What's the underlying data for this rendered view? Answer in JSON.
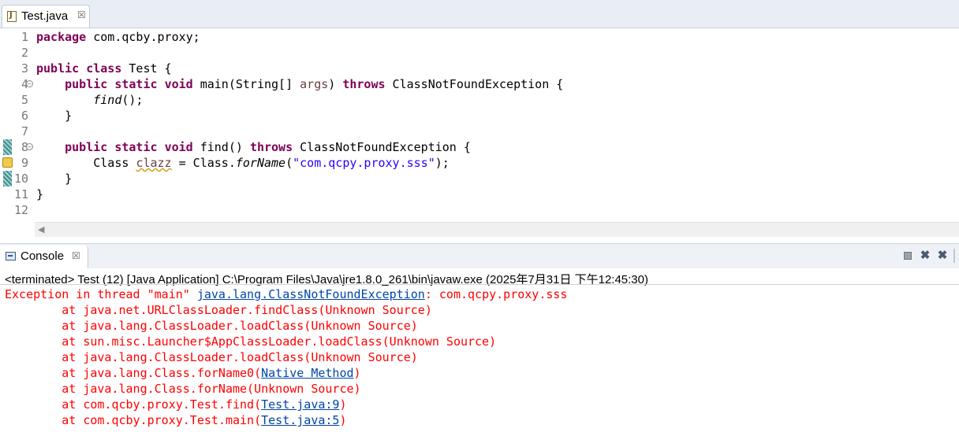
{
  "editor": {
    "tab": {
      "title": "Test.java",
      "close": "☒"
    },
    "lines": [
      {
        "num": "1",
        "tokens": [
          {
            "t": "package",
            "c": "kw"
          },
          {
            "t": " com.qcby.proxy;"
          }
        ]
      },
      {
        "num": "2",
        "tokens": []
      },
      {
        "num": "3",
        "tokens": [
          {
            "t": "public",
            "c": "kw"
          },
          {
            "t": " "
          },
          {
            "t": "class",
            "c": "kw"
          },
          {
            "t": " Test {"
          }
        ]
      },
      {
        "num": "4",
        "tokens": [
          {
            "t": "    "
          },
          {
            "t": "public",
            "c": "kw"
          },
          {
            "t": " "
          },
          {
            "t": "static",
            "c": "kw"
          },
          {
            "t": " "
          },
          {
            "t": "void",
            "c": "kw"
          },
          {
            "t": " main(String[] "
          },
          {
            "t": "args",
            "c": "param"
          },
          {
            "t": ") "
          },
          {
            "t": "throws",
            "c": "kw"
          },
          {
            "t": " ClassNotFoundException {"
          }
        ]
      },
      {
        "num": "5",
        "tokens": [
          {
            "t": "        "
          },
          {
            "t": "find",
            "c": "ital"
          },
          {
            "t": "();"
          }
        ]
      },
      {
        "num": "6",
        "tokens": [
          {
            "t": "    }"
          }
        ]
      },
      {
        "num": "7",
        "tokens": []
      },
      {
        "num": "8",
        "tokens": [
          {
            "t": "    "
          },
          {
            "t": "public",
            "c": "kw"
          },
          {
            "t": " "
          },
          {
            "t": "static",
            "c": "kw"
          },
          {
            "t": " "
          },
          {
            "t": "void",
            "c": "kw"
          },
          {
            "t": " find() "
          },
          {
            "t": "throws",
            "c": "kw"
          },
          {
            "t": " ClassNotFoundException {"
          }
        ]
      },
      {
        "num": "9",
        "tokens": [
          {
            "t": "        Class "
          },
          {
            "t": "clazz",
            "c": "warnvar"
          },
          {
            "t": " = Class."
          },
          {
            "t": "forName",
            "c": "ital"
          },
          {
            "t": "("
          },
          {
            "t": "\"com.qcpy.proxy.sss\"",
            "c": "str"
          },
          {
            "t": ");"
          }
        ]
      },
      {
        "num": "10",
        "tokens": [
          {
            "t": "    }"
          }
        ]
      },
      {
        "num": "11",
        "tokens": [
          {
            "t": "}"
          }
        ]
      },
      {
        "num": "12",
        "tokens": []
      }
    ]
  },
  "console": {
    "tab": {
      "title": "Console",
      "close": "☒"
    },
    "toolbar": {
      "remove": "✖",
      "remove_all": "✖"
    },
    "status": "<terminated> Test (12) [Java Application] C:\\Program Files\\Java\\jre1.8.0_261\\bin\\javaw.exe (2025年7月31日 下午12:45:30)",
    "output": [
      [
        {
          "t": "Exception in thread \"main\" "
        },
        {
          "t": "java.lang.ClassNotFoundException",
          "c": "link"
        },
        {
          "t": ": com.qcpy.proxy.sss"
        }
      ],
      [
        {
          "t": "\tat java.net.URLClassLoader.findClass(Unknown Source)"
        }
      ],
      [
        {
          "t": "\tat java.lang.ClassLoader.loadClass(Unknown Source)"
        }
      ],
      [
        {
          "t": "\tat sun.misc.Launcher$AppClassLoader.loadClass(Unknown Source)"
        }
      ],
      [
        {
          "t": "\tat java.lang.ClassLoader.loadClass(Unknown Source)"
        }
      ],
      [
        {
          "t": "\tat java.lang.Class.forName0("
        },
        {
          "t": "Native Method",
          "c": "link"
        },
        {
          "t": ")"
        }
      ],
      [
        {
          "t": "\tat java.lang.Class.forName(Unknown Source)"
        }
      ],
      [
        {
          "t": "\tat com.qcby.proxy.Test.find("
        },
        {
          "t": "Test.java:9",
          "c": "link"
        },
        {
          "t": ")"
        }
      ],
      [
        {
          "t": "\tat com.qcby.proxy.Test.main("
        },
        {
          "t": "Test.java:5",
          "c": "link"
        },
        {
          "t": ")"
        }
      ]
    ]
  }
}
